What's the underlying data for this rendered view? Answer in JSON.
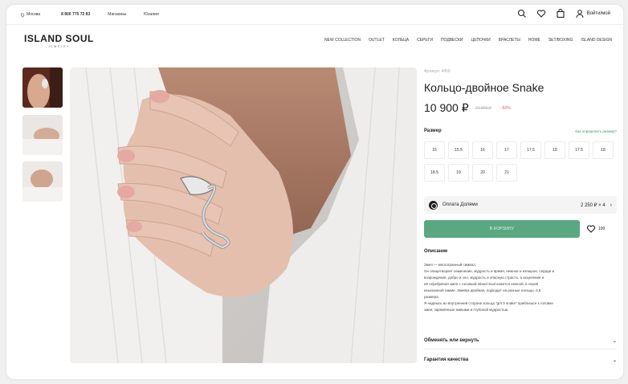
{
  "topbar": {
    "city": "Москва",
    "phone": "8 800 775 72 83",
    "stores": "Магазины",
    "service": "Юзалия"
  },
  "header": {
    "logo": "ISLAND SOUL",
    "logo_sub": "JEWELRY",
    "account": "Войти/мой",
    "nav": [
      "NEW COLLECTION",
      "OUTLET",
      "КОЛЬЦА",
      "СЕРЬГИ",
      "ПОДВЕСКИ",
      "ЦЕПОЧКИ",
      "БРАСЛЕТЫ",
      "HOME",
      "SET/BOXING",
      "ISLAND DESIGN"
    ]
  },
  "product": {
    "article": "Артикул: 4459",
    "title": "Кольцо-двойное Snake",
    "price": "10 900 ₽",
    "old_price": "21 800 ₽",
    "discount": "-50%",
    "size_label": "Размер",
    "size_link": "Как определить размер?",
    "sizes": [
      "15",
      "15.5",
      "16",
      "17",
      "17.5",
      "18",
      "17.5",
      "18",
      "18.5",
      "19",
      "20",
      "21"
    ],
    "dolyame_label": "Оплата Долями",
    "dolyame_amount": "2 250 ₽ × 4",
    "cart_button": "В КОРЗИНУ",
    "fav_count": "100",
    "desc_title": "Описание",
    "desc_lines": [
      "Змея — многогранный символ.",
      "Он олицетворяет изменение, мудрость и время, нежное и изящное, сердце и",
      "возрождение, добро и зло, мудрость и опасную страсть, а исцеление и",
      "её серебряная змея с головкой Island Soul кажется нежной, в серой",
      "изысканной гамме. Змейка двойная, подходит на разные пальцы. 0,5",
      "размера.",
      "Я надеюсь во внутренней стороне кольца \"grit 3 snake\" приблизьте к головке",
      "змеи, заряжённые живыми и глубокой мудростью."
    ],
    "accordion": [
      "Обменять или вернуть",
      "Гарантия качества"
    ]
  },
  "colors": {
    "accent": "#5aa882",
    "discount": "#e25a5a",
    "link": "#3e9b6b"
  }
}
